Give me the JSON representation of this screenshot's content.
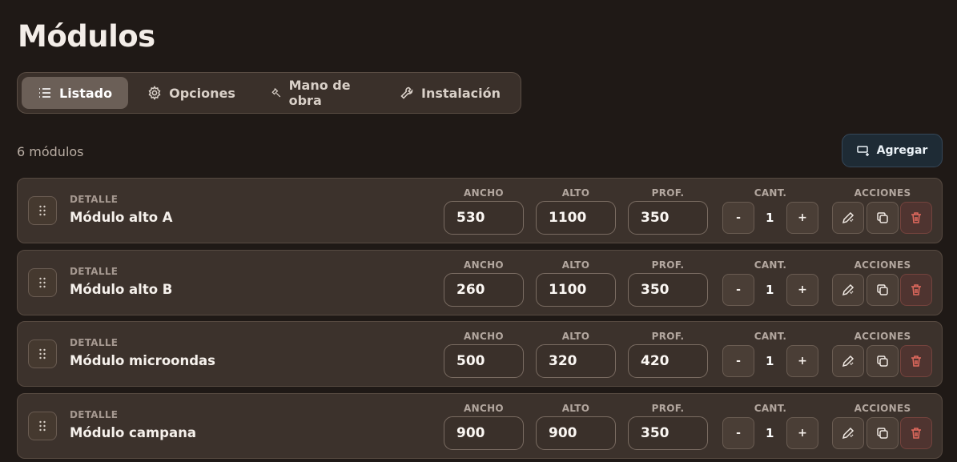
{
  "page": {
    "title": "Módulos"
  },
  "tabs": [
    {
      "label": "Listado",
      "icon": "list-icon",
      "active": true
    },
    {
      "label": "Opciones",
      "icon": "gear-icon",
      "active": false
    },
    {
      "label": "Mano de obra",
      "icon": "hammer-icon",
      "active": false
    },
    {
      "label": "Instalación",
      "icon": "wrench-icon",
      "active": false
    }
  ],
  "summary": {
    "count_text": "6 módulos"
  },
  "toolbar": {
    "add_label": "Agregar",
    "add_icon": "add-module-icon"
  },
  "columns": {
    "detail": "DETALLE",
    "width": "ANCHO",
    "height": "ALTO",
    "depth": "PROF.",
    "qty": "CANT.",
    "actions": "ACCIONES"
  },
  "steppers": {
    "minus": "-",
    "plus": "+"
  },
  "modules": [
    {
      "name": "Módulo alto A",
      "width": "530",
      "height": "1100",
      "depth": "350",
      "qty": "1"
    },
    {
      "name": "Módulo alto B",
      "width": "260",
      "height": "1100",
      "depth": "350",
      "qty": "1"
    },
    {
      "name": "Módulo microondas",
      "width": "500",
      "height": "320",
      "depth": "420",
      "qty": "1"
    },
    {
      "name": "Módulo campana",
      "width": "900",
      "height": "900",
      "depth": "350",
      "qty": "1"
    }
  ],
  "colors": {
    "background": "#1f1916",
    "row": "#3c322c",
    "add_button": "#1e2b35",
    "delete_accent": "#e26a5e"
  }
}
